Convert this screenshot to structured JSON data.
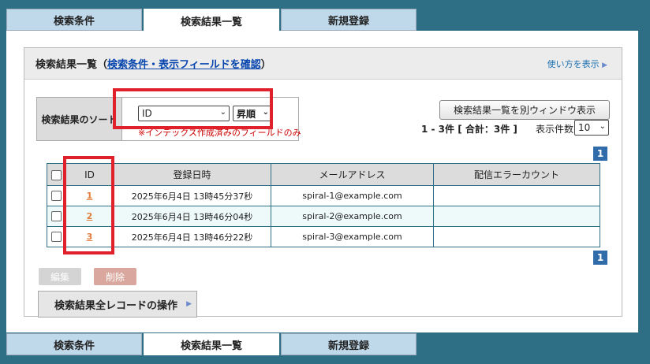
{
  "tabs": [
    "検索条件",
    "検索結果一覧",
    "新規登録"
  ],
  "header": {
    "title": "検索結果一覧",
    "open_paren": "（",
    "link": "検索条件・表示フィールドを確認",
    "close_paren": "）",
    "help": "使い方を表示"
  },
  "sort": {
    "label": "検索結果のソート",
    "field": "ID",
    "order": "昇順",
    "note": "※インデックス作成済みのフィールドのみ"
  },
  "toolbar": {
    "popup_button": "検索結果一覧を別ウィンドウ表示",
    "count": "1 - 3件 [ 合計：3件 ]",
    "per_page_label": "表示件数",
    "per_page": "10",
    "page": "1"
  },
  "table": {
    "headers": [
      "ID",
      "登録日時",
      "メールアドレス",
      "配信エラーカウント"
    ],
    "rows": [
      {
        "id": "1",
        "date": "2025年6月4日 13時45分37秒",
        "email": "spiral-1@example.com",
        "errors": ""
      },
      {
        "id": "2",
        "date": "2025年6月4日 13時46分04秒",
        "email": "spiral-2@example.com",
        "errors": ""
      },
      {
        "id": "3",
        "date": "2025年6月4日 13時46分22秒",
        "email": "spiral-3@example.com",
        "errors": ""
      }
    ]
  },
  "actions": {
    "edit": "編集",
    "delete": "削除",
    "all_records": "検索結果全レコードの操作"
  },
  "colors": {
    "background": "#2f6f86",
    "tab": "#c0d9ea",
    "highlight": "#e0202a",
    "id_link": "#e07b39"
  }
}
